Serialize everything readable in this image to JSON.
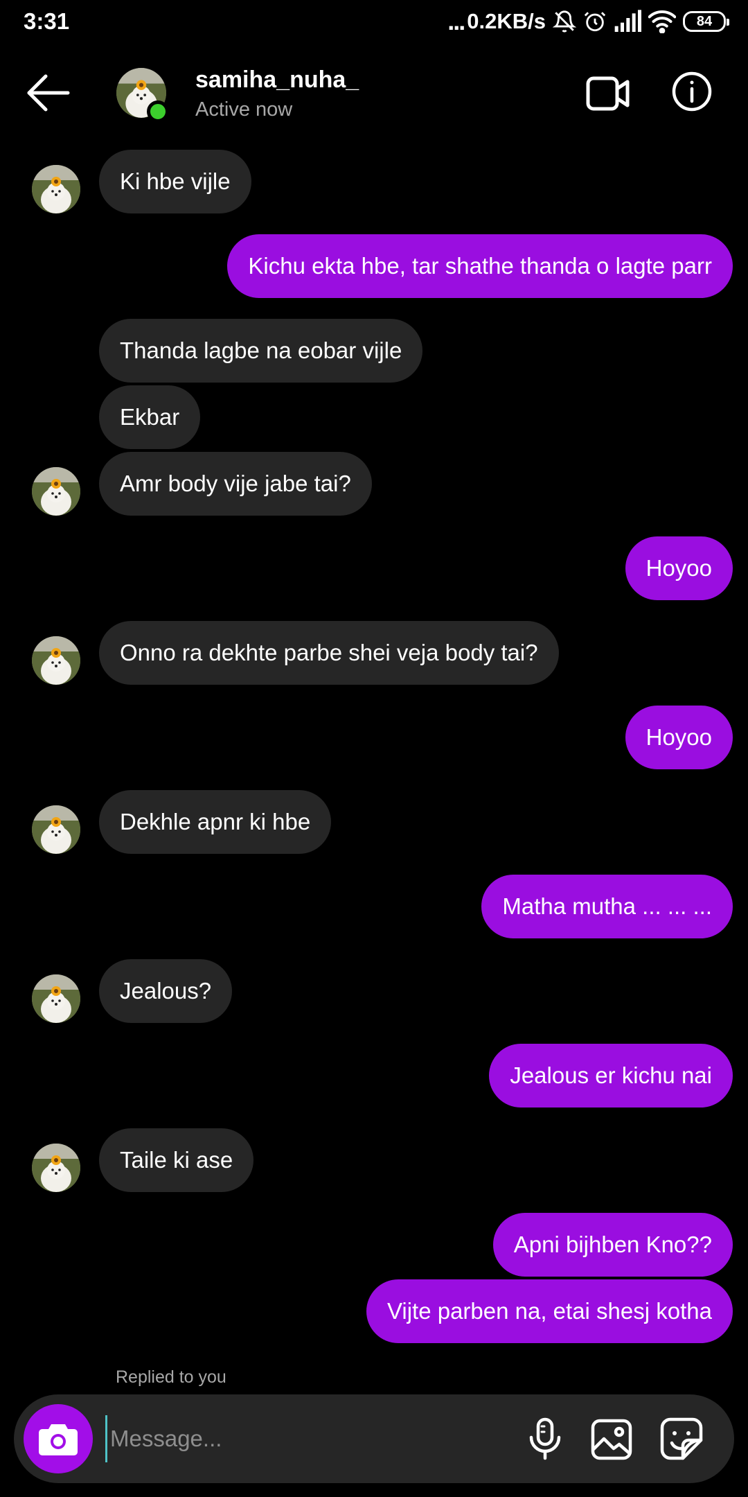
{
  "status_bar": {
    "time": "3:31",
    "dots": "...",
    "net_speed": "0.2KB/s",
    "battery": "84",
    "icons": [
      "bell-muted-icon",
      "alarm-icon",
      "signal-icon",
      "wifi-icon",
      "battery-icon"
    ]
  },
  "header": {
    "username": "samiha_nuha_",
    "status": "Active now",
    "icons": [
      "back-arrow-icon",
      "video-call-icon",
      "info-icon"
    ],
    "online_color": "#3ccf2d"
  },
  "messages": [
    {
      "from": "them",
      "text": "Ki hbe vijle",
      "avatar": true
    },
    {
      "from": "me",
      "text": "Kichu ekta hbe, tar shathe thanda o lagte parr"
    },
    {
      "from": "them",
      "text": "Thanda lagbe na eobar vijle",
      "avatar": false
    },
    {
      "from": "them",
      "text": "Ekbar",
      "avatar": false
    },
    {
      "from": "them",
      "text": "Amr body vije jabe tai?",
      "avatar": true
    },
    {
      "from": "me",
      "text": "Hoyoo"
    },
    {
      "from": "them",
      "text": "Onno ra dekhte parbe shei veja body tai?",
      "avatar": true
    },
    {
      "from": "me",
      "text": "Hoyoo"
    },
    {
      "from": "them",
      "text": "Dekhle apnr ki hbe",
      "avatar": true
    },
    {
      "from": "me",
      "text": "Matha mutha ... ... ..."
    },
    {
      "from": "them",
      "text": "Jealous?",
      "avatar": true
    },
    {
      "from": "me",
      "text": "Jealous er kichu nai"
    },
    {
      "from": "them",
      "text": "Taile ki ase",
      "avatar": true
    },
    {
      "from": "me",
      "text": "Apni bijhben Kno??"
    },
    {
      "from": "me",
      "text": "Vijte parben na, etai shesj kotha"
    }
  ],
  "reply_note": "Replied to you",
  "composer": {
    "placeholder": "Message...",
    "value": "",
    "icons": [
      "camera-icon",
      "microphone-icon",
      "gallery-icon",
      "sticker-icon"
    ]
  },
  "colors": {
    "outgoing_bubble": "#9a0ee0",
    "incoming_bubble": "#262626",
    "camera_button": "#a20ee8",
    "background": "#000000"
  }
}
